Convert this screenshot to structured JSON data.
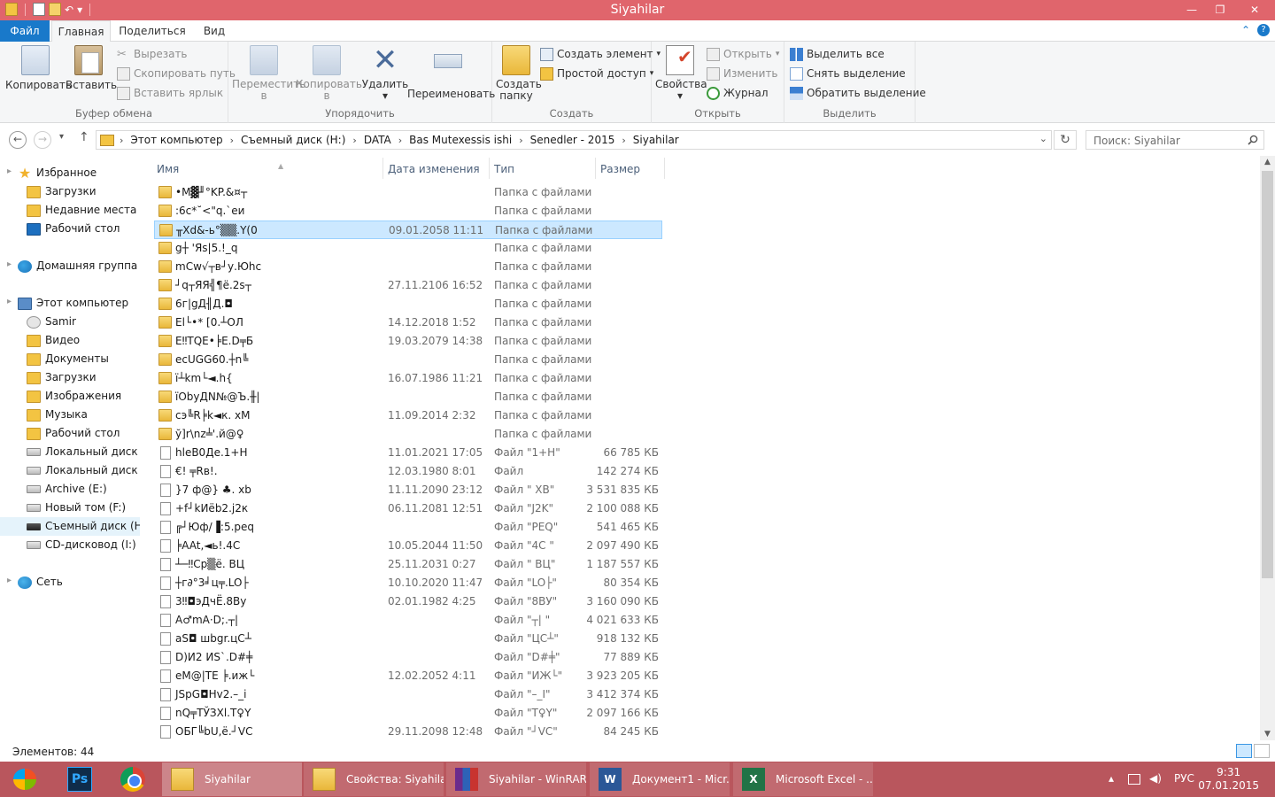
{
  "window": {
    "title": "Siyahilar",
    "minimize_glyph": "—",
    "maximize_glyph": "❐",
    "close_glyph": "✕"
  },
  "qat": {
    "undo_glyph": "↶",
    "dropdown_glyph": "▾"
  },
  "tabs": {
    "file": "Файл",
    "home": "Главная",
    "share": "Поделиться",
    "view": "Вид",
    "collapse_glyph": "⌃",
    "help_glyph": "?"
  },
  "ribbon": {
    "clipboard": {
      "label": "Буфер обмена",
      "copy": "Копировать",
      "paste": "Вставить",
      "cut": "Вырезать",
      "copy_path": "Скопировать путь",
      "paste_shortcut": "Вставить ярлык"
    },
    "organize": {
      "label": "Упорядочить",
      "move_to_1": "Переместить",
      "move_to_2": "в",
      "copy_to_1": "Копировать",
      "copy_to_2": "в",
      "delete": "Удалить",
      "rename": "Переименовать",
      "dropdown_glyph": "▾"
    },
    "create": {
      "label": "Создать",
      "new_folder_1": "Создать",
      "new_folder_2": "папку",
      "new_item": "Создать элемент",
      "easy_access": "Простой доступ"
    },
    "open": {
      "label": "Открыть",
      "properties": "Свойства",
      "open": "Открыть",
      "edit": "Изменить",
      "history": "Журнал"
    },
    "select": {
      "label": "Выделить",
      "select_all": "Выделить все",
      "select_none": "Снять выделение",
      "invert": "Обратить выделение"
    }
  },
  "address": {
    "back_glyph": "←",
    "forward_glyph": "→",
    "recent_glyph": "▾",
    "up_glyph": "↑",
    "crumb_sep": "›",
    "crumbs": [
      "Этот компьютер",
      "Съемный диск (H:)",
      "DATA",
      "Bas Mutexessis ishi",
      "Senedler - 2015",
      "Siyahilar"
    ],
    "drop_glyph": "⌄",
    "refresh_glyph": "↻",
    "search_placeholder": "Поиск: Siyahilar"
  },
  "nav": {
    "favorites": "Избранное",
    "fav_items": [
      "Загрузки",
      "Недавние места",
      "Рабочий стол"
    ],
    "homegroup": "Домашняя группа",
    "this_pc": "Этот компьютер",
    "pc_items": [
      "Samir",
      "Видео",
      "Документы",
      "Загрузки",
      "Изображения",
      "Музыка",
      "Рабочий стол",
      "Локальный диск (C",
      "Локальный диск (D",
      "Archive (E:)",
      "Новый том (F:)",
      "Съемный диск (H:)",
      "CD-дисковод (I:)"
    ],
    "network": "Сеть",
    "expand_glyph": "▸",
    "star_glyph": "★"
  },
  "columns": {
    "name": "Имя",
    "date": "Дата изменения",
    "type": "Тип",
    "size": "Размер",
    "sort_glyph": "▲"
  },
  "files": [
    {
      "kind": "folder",
      "name": "•M▓╜°KP.&¤┬",
      "date": "",
      "type": "Папка с файлами",
      "size": ""
    },
    {
      "kind": "folder",
      "name": ":6c*˘<\"q.`еи",
      "date": "",
      "type": "Папка с файлами",
      "size": ""
    },
    {
      "kind": "folder",
      "name": "╥Xd&-ь°▒▒.Y(0",
      "date": "09.01.2058 11:11",
      "type": "Папка с файлами",
      "size": ""
    },
    {
      "kind": "folder",
      "name": "g┼ 'Яs|5.!_q",
      "date": "",
      "type": "Папка с файлами",
      "size": ""
    },
    {
      "kind": "folder",
      "name": "mCw√┬в┘у.Юhc",
      "date": "",
      "type": "Папка с файлами",
      "size": ""
    },
    {
      "kind": "folder",
      "name": "┘q┬ЯЯ╣¶ë.2s┬",
      "date": "27.11.2106 16:52",
      "type": "Папка с файлами",
      "size": ""
    },
    {
      "kind": "folder",
      "name": "6г|gД╢Д.◘",
      "date": "",
      "type": "Папка с файлами",
      "size": ""
    },
    {
      "kind": "folder",
      "name": "El└•* [0.┴ОЛ",
      "date": "14.12.2018 1:52",
      "type": "Папка с файлами",
      "size": ""
    },
    {
      "kind": "folder",
      "name": "E‼TQE•╞E.D╤Б",
      "date": "19.03.2079 14:38",
      "type": "Папка с файлами",
      "size": ""
    },
    {
      "kind": "folder",
      "name": "ecUGG60.┼n╚",
      "date": "",
      "type": "Папка с файлами",
      "size": ""
    },
    {
      "kind": "folder",
      "name": "ї┴km└◄.h{",
      "date": "16.07.1986 11:21",
      "type": "Папка с файлами",
      "size": ""
    },
    {
      "kind": "folder",
      "name": "їObyДN№@Ъ.╫|",
      "date": "",
      "type": "Папка с файлами",
      "size": ""
    },
    {
      "kind": "folder",
      "name": "сэ╚R╞k◄к. хМ",
      "date": "11.09.2014 2:32",
      "type": "Папка с файлами",
      "size": ""
    },
    {
      "kind": "folder",
      "name": "ў]r\\nz╧'.й@♀",
      "date": "",
      "type": "Папка с файлами",
      "size": ""
    },
    {
      "kind": "file",
      "name": "hleB0Де.1+H",
      "date": "11.01.2021 17:05",
      "type": "Файл \"1+H\"",
      "size": "66 785 КБ"
    },
    {
      "kind": "file",
      "name": "€! ╤Rв!.",
      "date": "12.03.1980 8:01",
      "type": "Файл",
      "size": "142 274 КБ"
    },
    {
      "kind": "file",
      "name": "}7 ф@} ♣. xb",
      "date": "11.11.2090 23:12",
      "type": "Файл \" XB\"",
      "size": "3 531 835 КБ"
    },
    {
      "kind": "file",
      "name": "+f┘kИёb2.j2к",
      "date": "06.11.2081 12:51",
      "type": "Файл \"J2K\"",
      "size": "2 100 088 КБ"
    },
    {
      "kind": "file",
      "name": "╔┘Юф/▐:5.peq",
      "date": "",
      "type": "Файл \"PEQ\"",
      "size": "541 465 КБ"
    },
    {
      "kind": "file",
      "name": "╞AAt,◄ь!.4C",
      "date": "10.05.2044 11:50",
      "type": "Файл \"4C \"",
      "size": "2 097 490 КБ"
    },
    {
      "kind": "file",
      "name": "┴─‼Cp▒ё. ВЦ",
      "date": "25.11.2031 0:27",
      "type": "Файл \" ВЦ\"",
      "size": "1 187 557 КБ"
    },
    {
      "kind": "file",
      "name": "┼г∂°3╛ц╤.LO├",
      "date": "10.10.2020 11:47",
      "type": "Файл \"LO├\"",
      "size": "80 354 КБ"
    },
    {
      "kind": "file",
      "name": "3‼◘эДчЁ.8Ву",
      "date": "02.01.1982 4:25",
      "type": "Файл \"8ВУ\"",
      "size": "3 160 090 КБ"
    },
    {
      "kind": "file",
      "name": "A♂mA·D;.┬|",
      "date": "",
      "type": "Файл \"┬| \"",
      "size": "4 021 633 КБ"
    },
    {
      "kind": "file",
      "name": "aS◘ шbgr.цС┴",
      "date": "",
      "type": "Файл \"ЦС┴\"",
      "size": "918 132 КБ"
    },
    {
      "kind": "file",
      "name": "D)И2 ИS`.D#╪",
      "date": "",
      "type": "Файл \"D#╪\"",
      "size": "77 889 КБ"
    },
    {
      "kind": "file",
      "name": "eM@|TE ╞.иж└",
      "date": "12.02.2052 4:11",
      "type": "Файл \"ИЖ└\"",
      "size": "3 923 205 КБ"
    },
    {
      "kind": "file",
      "name": "JSpG◘Hv2.–_i",
      "date": "",
      "type": "Файл \"–_I\"",
      "size": "3 412 374 КБ"
    },
    {
      "kind": "file",
      "name": "nQ╤ТЎЗХl.Т♀Y",
      "date": "",
      "type": "Файл \"Т♀Y\"",
      "size": "2 097 166 КБ"
    },
    {
      "kind": "file",
      "name": "ОБГ╚bU,ё.┘VC",
      "date": "29.11.2098 12:48",
      "type": "Файл \"┘VC\"",
      "size": "84 245 КБ"
    }
  ],
  "scroll": {
    "up_glyph": "▲",
    "down_glyph": "▼"
  },
  "status": {
    "items": "Элементов: 44"
  },
  "taskbar": {
    "ps_label": "Ps",
    "tasks": [
      "Siyahilar",
      "Свойства: Siyahilar",
      "Siyahilar - WinRAR",
      "Документ1 - Micr...",
      "Microsoft Excel - ..."
    ],
    "word_glyph": "W",
    "excel_glyph": "X",
    "tray_up": "▴",
    "lang": "РУС",
    "time": "9:31",
    "date": "07.01.2015"
  }
}
